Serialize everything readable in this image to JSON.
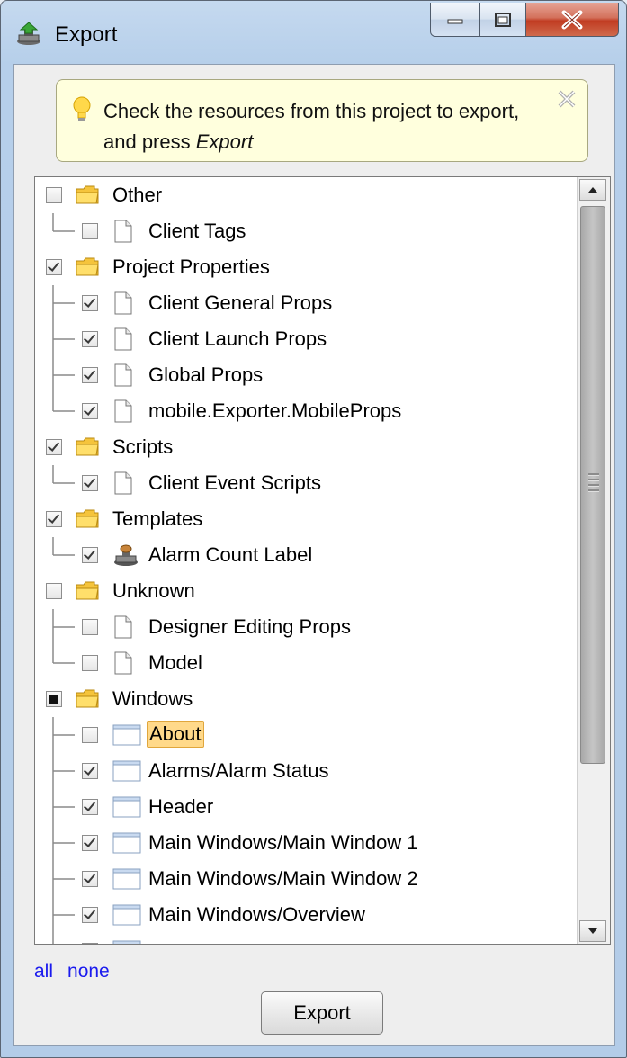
{
  "window": {
    "title": "Export",
    "icon": "export-stamp-icon",
    "buttons": [
      "minimize-icon",
      "maximize-icon",
      "close-icon"
    ]
  },
  "tip": {
    "text_before": "Check the resources from this project to export, and press ",
    "text_emphasis": "Export",
    "icon": "lightbulb-icon"
  },
  "tree": {
    "rows": [
      {
        "label": "Other",
        "level": 0,
        "checked": "off",
        "icon": "folder-icon"
      },
      {
        "label": "Client Tags",
        "level": 1,
        "checked": "off",
        "icon": "document-icon",
        "last": true
      },
      {
        "label": "Project Properties",
        "level": 0,
        "checked": "on",
        "icon": "folder-icon"
      },
      {
        "label": "Client General Props",
        "level": 1,
        "checked": "on",
        "icon": "document-icon"
      },
      {
        "label": "Client Launch Props",
        "level": 1,
        "checked": "on",
        "icon": "document-icon"
      },
      {
        "label": "Global Props",
        "level": 1,
        "checked": "on",
        "icon": "document-icon"
      },
      {
        "label": "mobile.Exporter.MobileProps",
        "level": 1,
        "checked": "on",
        "icon": "document-icon",
        "last": true
      },
      {
        "label": "Scripts",
        "level": 0,
        "checked": "on",
        "icon": "folder-icon"
      },
      {
        "label": "Client Event Scripts",
        "level": 1,
        "checked": "on",
        "icon": "document-icon",
        "last": true
      },
      {
        "label": "Templates",
        "level": 0,
        "checked": "on",
        "icon": "folder-icon"
      },
      {
        "label": "Alarm Count Label",
        "level": 1,
        "checked": "on",
        "icon": "template-stamp-icon",
        "last": true
      },
      {
        "label": "Unknown",
        "level": 0,
        "checked": "off",
        "icon": "folder-icon"
      },
      {
        "label": "Designer Editing Props",
        "level": 1,
        "checked": "off",
        "icon": "document-icon"
      },
      {
        "label": "Model",
        "level": 1,
        "checked": "off",
        "icon": "document-icon",
        "last": true
      },
      {
        "label": "Windows",
        "level": 0,
        "checked": "partial",
        "icon": "folder-icon"
      },
      {
        "label": "About",
        "level": 1,
        "checked": "off",
        "icon": "window-icon",
        "selected": true
      },
      {
        "label": "Alarms/Alarm Status",
        "level": 1,
        "checked": "on",
        "icon": "window-icon"
      },
      {
        "label": "Header",
        "level": 1,
        "checked": "on",
        "icon": "window-icon"
      },
      {
        "label": "Main Windows/Main Window 1",
        "level": 1,
        "checked": "on",
        "icon": "window-icon"
      },
      {
        "label": "Main Windows/Main Window 2",
        "level": 1,
        "checked": "on",
        "icon": "window-icon"
      },
      {
        "label": "Main Windows/Overview",
        "level": 1,
        "checked": "on",
        "icon": "window-icon"
      },
      {
        "label": "",
        "level": 1,
        "checked": "on",
        "icon": "window-icon"
      }
    ]
  },
  "links": {
    "all": "all",
    "none": "none"
  },
  "export_button": "Export"
}
